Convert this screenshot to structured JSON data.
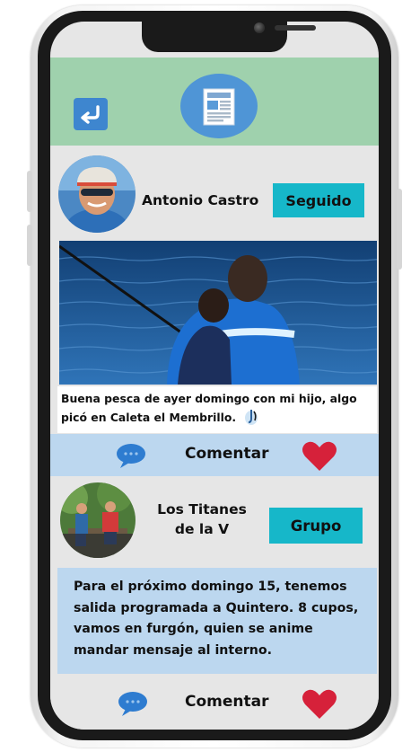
{
  "feed": {
    "posts": [
      {
        "author": "Antonio Castro",
        "follow_label": "Seguido",
        "caption": "Buena pesca de ayer domingo con mi hijo, algo picó en Caleta el Membrillo.",
        "comment_label": "Comentar"
      },
      {
        "author_line1": "Los Titanes",
        "author_line2": "de la V",
        "group_label": "Grupo",
        "text": "Para el próximo domingo 15, tenemos salida programada a Quintero. 8 cupos, vamos en furgón, quien se anime mandar mensaje al interno.",
        "comment_label": "Comentar"
      }
    ]
  },
  "colors": {
    "header_bg": "#9fd1ad",
    "accent_blue": "#3e86cf",
    "teal_button": "#16b7c9",
    "comment_bar": "#bcd7ef",
    "heart": "#d6213a"
  },
  "icons": {
    "back": "return-arrow-icon",
    "header": "newspaper-icon",
    "comment": "speech-bubble-icon",
    "like": "heart-icon",
    "caption_badge": "fishing-hook-icon"
  }
}
